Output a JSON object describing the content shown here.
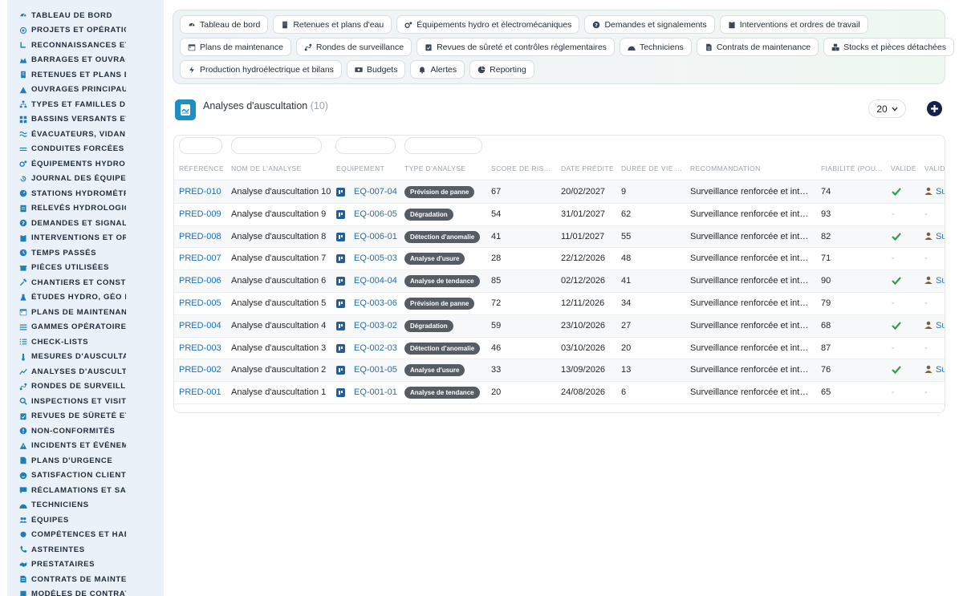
{
  "sidebar": {
    "items": [
      {
        "label": "Tableau de bord",
        "icon": "dashboard-icon"
      },
      {
        "label": "Projets et opération",
        "icon": "project-icon"
      },
      {
        "label": "Reconnaissances et v",
        "icon": "survey-icon"
      },
      {
        "label": "Barrages et ouvrage",
        "icon": "dam-icon"
      },
      {
        "label": "Retenues et plans d'e",
        "icon": "reservoir-icon"
      },
      {
        "label": "Ouvrages principaux",
        "icon": "structure-icon"
      },
      {
        "label": "Types et familles d'ou",
        "icon": "hierarchy-icon"
      },
      {
        "label": "Bassins versants et a",
        "icon": "grid-icon"
      },
      {
        "label": "Évacuateurs, vidange",
        "icon": "spillway-icon"
      },
      {
        "label": "Conduites forcées et",
        "icon": "pipe-icon"
      },
      {
        "label": "Équipements hydro et",
        "icon": "gears-icon"
      },
      {
        "label": "Journal des équipeme",
        "icon": "history-icon"
      },
      {
        "label": "Stations hydrométric",
        "icon": "gauge-icon"
      },
      {
        "label": "Relevés hydrologiqu",
        "icon": "sheet-icon"
      },
      {
        "label": "Demandes et signalem",
        "icon": "question-icon"
      },
      {
        "label": "Interventions et ordi",
        "icon": "clipboard-icon"
      },
      {
        "label": "Temps passés",
        "icon": "clock-icon"
      },
      {
        "label": "Pièces utilisées",
        "icon": "box-icon"
      },
      {
        "label": "Chantiers et constru",
        "icon": "hammer-icon"
      },
      {
        "label": "Études hydro, géo et",
        "icon": "flask-icon"
      },
      {
        "label": "Plans de maintenance",
        "icon": "calendar-icon"
      },
      {
        "label": "Gammes opératoires",
        "icon": "list-icon"
      },
      {
        "label": "Check-lists",
        "icon": "checklist-icon"
      },
      {
        "label": "Mesures d'auscultati",
        "icon": "thermometer-icon"
      },
      {
        "label": "Analyses d'auscultat",
        "icon": "chart-line-icon"
      },
      {
        "label": "Rondes de surveillan",
        "icon": "route-icon"
      },
      {
        "label": "Inspections et visites",
        "icon": "search-icon"
      },
      {
        "label": "Revues de sûreté et c",
        "icon": "clipboard-check-icon"
      },
      {
        "label": "Non-conformités",
        "icon": "alert-circle-icon"
      },
      {
        "label": "Incidents et événemen",
        "icon": "warning-icon"
      },
      {
        "label": "Plans d'urgence",
        "icon": "file-alert-icon"
      },
      {
        "label": "Satisfaction client",
        "icon": "smile-icon"
      },
      {
        "label": "Réclamations et SAV",
        "icon": "comment-icon"
      },
      {
        "label": "Techniciens",
        "icon": "helmet-icon"
      },
      {
        "label": "Équipes",
        "icon": "users-icon"
      },
      {
        "label": "Compétences et habil",
        "icon": "certificate-icon"
      },
      {
        "label": "Astreintes",
        "icon": "phone-icon"
      },
      {
        "label": "Prestataires",
        "icon": "handshake-icon"
      },
      {
        "label": "Contrats de maintena",
        "icon": "contract-icon"
      },
      {
        "label": "Modèles de contrats",
        "icon": "template-icon"
      }
    ]
  },
  "topnav": {
    "rows": [
      [
        {
          "label": "Tableau de bord",
          "icon": "dashboard-icon"
        },
        {
          "label": "Retenues et plans d'eau",
          "icon": "building-icon"
        },
        {
          "label": "Équipements hydro et électromécaniques",
          "icon": "gears-icon"
        },
        {
          "label": "Demandes et signalements",
          "icon": "question-icon"
        },
        {
          "label": "Interventions et ordres de travail",
          "icon": "clipboard-icon"
        }
      ],
      [
        {
          "label": "Plans de maintenance",
          "icon": "calendar-icon"
        },
        {
          "label": "Rondes de surveillance",
          "icon": "route-icon"
        },
        {
          "label": "Revues de sûreté et contrôles réglementaires",
          "icon": "clipboard-check-icon"
        },
        {
          "label": "Techniciens",
          "icon": "helmet-icon"
        },
        {
          "label": "Contrats de maintenance",
          "icon": "file-icon"
        },
        {
          "label": "Stocks et pièces détachées",
          "icon": "boxes-icon"
        }
      ],
      [
        {
          "label": "Production hydroélectrique et bilans",
          "icon": "bolt-icon"
        },
        {
          "label": "Budgets",
          "icon": "money-icon"
        },
        {
          "label": "Alertes",
          "icon": "bell-icon"
        },
        {
          "label": "Reporting",
          "icon": "pie-icon"
        }
      ]
    ]
  },
  "page": {
    "title": "Analyses d'auscultation",
    "count": "(10)",
    "per_page": "20",
    "accent": "#1d8fc4"
  },
  "table": {
    "columns": [
      "Référence",
      "Nom de l'analyse",
      "Équipement",
      "Type d'analyse",
      "Score de ris...",
      "Date prédite",
      "Durée de vie ...",
      "Recommandation",
      "Fiabilité (pou...",
      "Validé",
      "Valida"
    ],
    "rows": [
      {
        "ref": "PRED-010",
        "name": "Analyse d'auscultation 10",
        "equip": "EQ-007-04",
        "type": "Prévision de panne",
        "score": "67",
        "date": "20/02/2027",
        "life": "9",
        "reco": "Surveillance renforcée et intervention",
        "reliab": "74",
        "validated": true,
        "validator": "Su"
      },
      {
        "ref": "PRED-009",
        "name": "Analyse d'auscultation 9",
        "equip": "EQ-006-05",
        "type": "Dégradation",
        "score": "54",
        "date": "31/01/2027",
        "life": "62",
        "reco": "Surveillance renforcée et intervention",
        "reliab": "93",
        "validated": false,
        "validator": ""
      },
      {
        "ref": "PRED-008",
        "name": "Analyse d'auscultation 8",
        "equip": "EQ-006-01",
        "type": "Détection d'anomalie",
        "score": "41",
        "date": "11/01/2027",
        "life": "55",
        "reco": "Surveillance renforcée et intervention",
        "reliab": "82",
        "validated": true,
        "validator": "Su"
      },
      {
        "ref": "PRED-007",
        "name": "Analyse d'auscultation 7",
        "equip": "EQ-005-03",
        "type": "Analyse d'usure",
        "score": "28",
        "date": "22/12/2026",
        "life": "48",
        "reco": "Surveillance renforcée et intervention",
        "reliab": "71",
        "validated": false,
        "validator": ""
      },
      {
        "ref": "PRED-006",
        "name": "Analyse d'auscultation 6",
        "equip": "EQ-004-04",
        "type": "Analyse de tendance",
        "score": "85",
        "date": "02/12/2026",
        "life": "41",
        "reco": "Surveillance renforcée et intervention",
        "reliab": "90",
        "validated": true,
        "validator": "Su"
      },
      {
        "ref": "PRED-005",
        "name": "Analyse d'auscultation 5",
        "equip": "EQ-003-06",
        "type": "Prévision de panne",
        "score": "72",
        "date": "12/11/2026",
        "life": "34",
        "reco": "Surveillance renforcée et intervention",
        "reliab": "79",
        "validated": false,
        "validator": ""
      },
      {
        "ref": "PRED-004",
        "name": "Analyse d'auscultation 4",
        "equip": "EQ-003-02",
        "type": "Dégradation",
        "score": "59",
        "date": "23/10/2026",
        "life": "27",
        "reco": "Surveillance renforcée et intervention",
        "reliab": "68",
        "validated": true,
        "validator": "Su"
      },
      {
        "ref": "PRED-003",
        "name": "Analyse d'auscultation 3",
        "equip": "EQ-002-03",
        "type": "Détection d'anomalie",
        "score": "46",
        "date": "03/10/2026",
        "life": "20",
        "reco": "Surveillance renforcée et intervention",
        "reliab": "87",
        "validated": false,
        "validator": ""
      },
      {
        "ref": "PRED-002",
        "name": "Analyse d'auscultation 2",
        "equip": "EQ-001-05",
        "type": "Analyse d'usure",
        "score": "33",
        "date": "13/09/2026",
        "life": "13",
        "reco": "Surveillance renforcée et intervention",
        "reliab": "76",
        "validated": true,
        "validator": "Su"
      },
      {
        "ref": "PRED-001",
        "name": "Analyse d'auscultation 1",
        "equip": "EQ-001-01",
        "type": "Analyse de tendance",
        "score": "20",
        "date": "24/08/2026",
        "life": "6",
        "reco": "Surveillance renforcée et intervention",
        "reliab": "65",
        "validated": false,
        "validator": ""
      }
    ],
    "empty_mark": "-",
    "colors": {
      "link": "#1a6fb5",
      "check": "#2e9e4f",
      "badge": "#555c63"
    }
  }
}
